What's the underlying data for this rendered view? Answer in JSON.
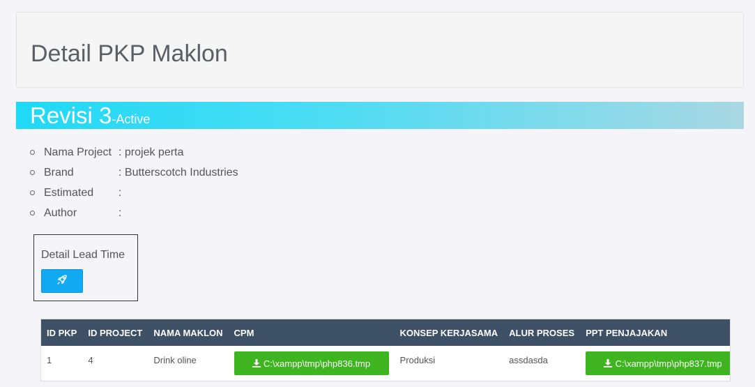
{
  "header": {
    "title": "Detail PKP Maklon"
  },
  "revision": {
    "label": "Revisi 3",
    "status": "-Active"
  },
  "info": [
    {
      "label": "Nama Project",
      "value": ": projek perta"
    },
    {
      "label": "Brand",
      "value": ": Butterscotch Industries"
    },
    {
      "label": "Estimated",
      "value": ":"
    },
    {
      "label": "Author",
      "value": ":"
    }
  ],
  "lead_time": {
    "title": "Detail Lead Time",
    "button_icon": "rocket-icon"
  },
  "colors": {
    "header_row": "#3e5066",
    "accent": "#11a9f2",
    "download": "#3eb51e"
  },
  "table": {
    "headers": [
      "ID PKP",
      "ID PROJECT",
      "NAMA MAKLON",
      "CPM",
      "KONSEP KERJASAMA",
      "ALUR PROSES",
      "PPT PENJAJAKAN"
    ],
    "rows": [
      {
        "id_pkp": "1",
        "id_project": "4",
        "nama_maklon": "Drink oline",
        "cpm_file": "C:\\xampp\\tmp\\php836.tmp",
        "konsep": "Produksi",
        "alur": "assdasda",
        "ppt_file": "C:\\xampp\\tmp\\php837.tmp"
      }
    ]
  }
}
